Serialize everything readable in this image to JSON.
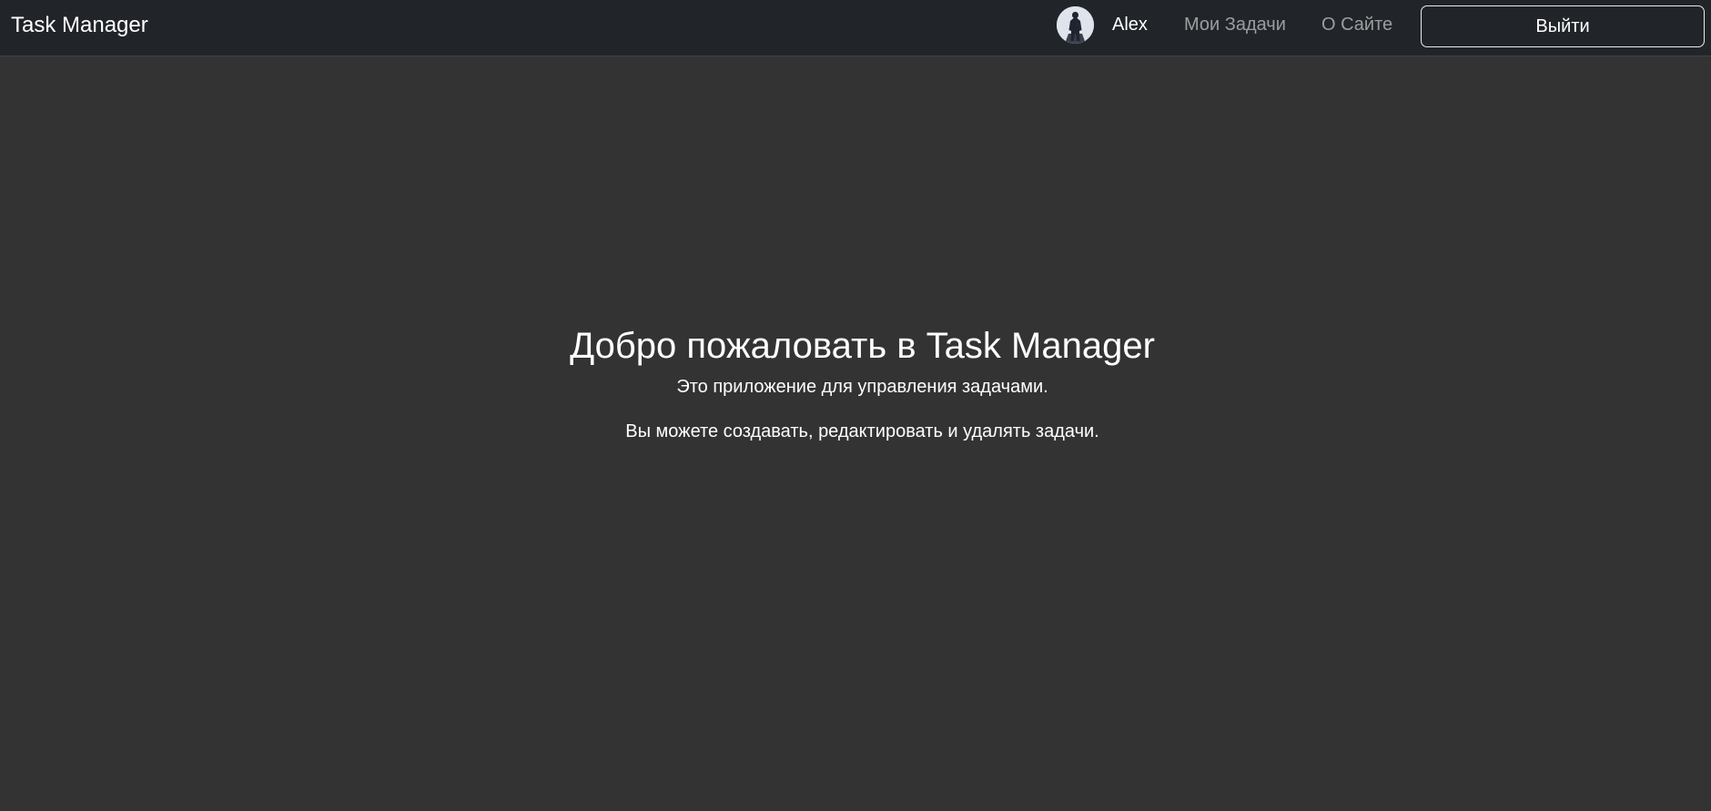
{
  "navbar": {
    "brand": "Task Manager",
    "user_name": "Alex",
    "links": [
      {
        "label": "Мои Задачи"
      },
      {
        "label": "О Сайте"
      }
    ],
    "logout_label": "Выйти",
    "avatar_icon": "user-avatar-icon"
  },
  "main": {
    "title": "Добро пожаловать в Task Manager",
    "line1": "Это приложение для управления задачами.",
    "line2": "Вы можете создавать, редактировать и удалять задачи."
  },
  "colors": {
    "navbar_bg": "#212529",
    "page_bg": "#333333",
    "text": "#ffffff",
    "muted_link": "rgba(255,255,255,0.55)"
  }
}
